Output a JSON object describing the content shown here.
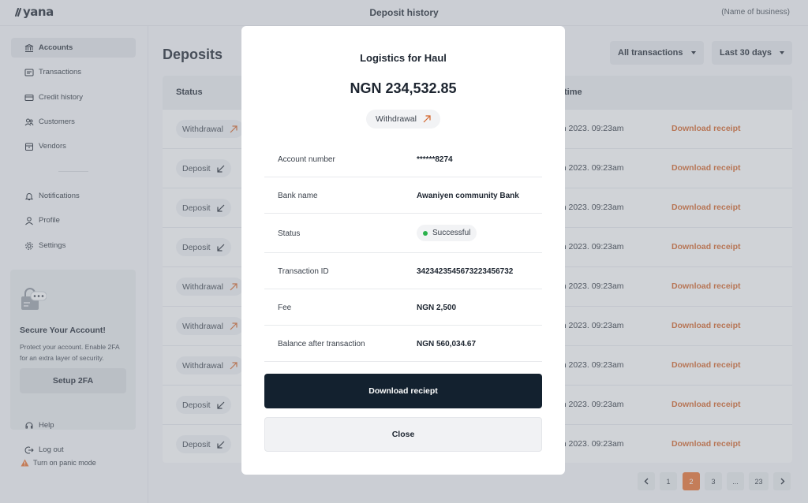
{
  "app": {
    "logo": "yana",
    "page_title": "Deposit history",
    "business_name": "(Name of business)"
  },
  "sidebar": {
    "items": [
      {
        "label": "Accounts",
        "icon": "bank-icon",
        "active": true
      },
      {
        "label": "Transactions",
        "icon": "transactions-icon"
      },
      {
        "label": "Credit history",
        "icon": "credit-card-icon"
      },
      {
        "label": "Customers",
        "icon": "customers-icon"
      },
      {
        "label": "Vendors",
        "icon": "vendors-icon"
      },
      {
        "label": "Notifications",
        "icon": "bell-icon"
      },
      {
        "label": "Profile",
        "icon": "user-icon"
      },
      {
        "label": "Settings",
        "icon": "gear-icon"
      }
    ],
    "secure": {
      "title": "Secure Your Account!",
      "description": "Protect your account. Enable 2FA for an extra layer of security.",
      "button": "Setup 2FA"
    },
    "help": "Help",
    "logout": "Log out",
    "panic": "Turn on panic mode"
  },
  "main": {
    "title": "Deposits",
    "filters": {
      "type": "All transactions",
      "range": "Last 30 days"
    },
    "columns": {
      "status": "Status",
      "time": "time"
    },
    "rows": [
      {
        "status": "Withdrawal",
        "dir": "out",
        "date": "rch 2023. 09:23am",
        "action": "Download receipt"
      },
      {
        "status": "Deposit",
        "dir": "in",
        "date": "rch 2023. 09:23am",
        "action": "Download receipt"
      },
      {
        "status": "Deposit",
        "dir": "in",
        "date": "rch 2023. 09:23am",
        "action": "Download receipt"
      },
      {
        "status": "Deposit",
        "dir": "in",
        "date": "rch 2023. 09:23am",
        "action": "Download receipt"
      },
      {
        "status": "Withdrawal",
        "dir": "out",
        "date": "rch 2023. 09:23am",
        "action": "Download receipt"
      },
      {
        "status": "Withdrawal",
        "dir": "out",
        "date": "rch 2023. 09:23am",
        "action": "Download receipt"
      },
      {
        "status": "Withdrawal",
        "dir": "out",
        "date": "rch 2023. 09:23am",
        "action": "Download receipt"
      },
      {
        "status": "Deposit",
        "dir": "in",
        "date": "rch 2023. 09:23am",
        "action": "Download receipt"
      },
      {
        "status": "Deposit",
        "dir": "in",
        "date": "rch 2023. 09:23am",
        "action": "Download receipt"
      }
    ],
    "pagination": {
      "pages": [
        "1",
        "2",
        "3",
        "...",
        "23"
      ],
      "current": "2"
    }
  },
  "modal": {
    "title": "Logistics for Haul",
    "amount": "NGN 234,532.85",
    "type": "Withdrawal",
    "details": [
      {
        "label": "Account number",
        "value": "******8274"
      },
      {
        "label": "Bank name",
        "value": "Awaniyen community Bank"
      },
      {
        "label": "Status",
        "value": "Successful"
      },
      {
        "label": "Transaction ID",
        "value": "3423423545673223456732"
      },
      {
        "label": "Fee",
        "value": "NGN 2,500"
      },
      {
        "label": "Balance after transaction",
        "value": "NGN 560,034.67"
      }
    ],
    "primary_button": "Download reciept",
    "secondary_button": "Close"
  },
  "colors": {
    "accent": "#e7702f",
    "link": "#d2642a",
    "dark": "#13212f",
    "success": "#2bb24c"
  }
}
